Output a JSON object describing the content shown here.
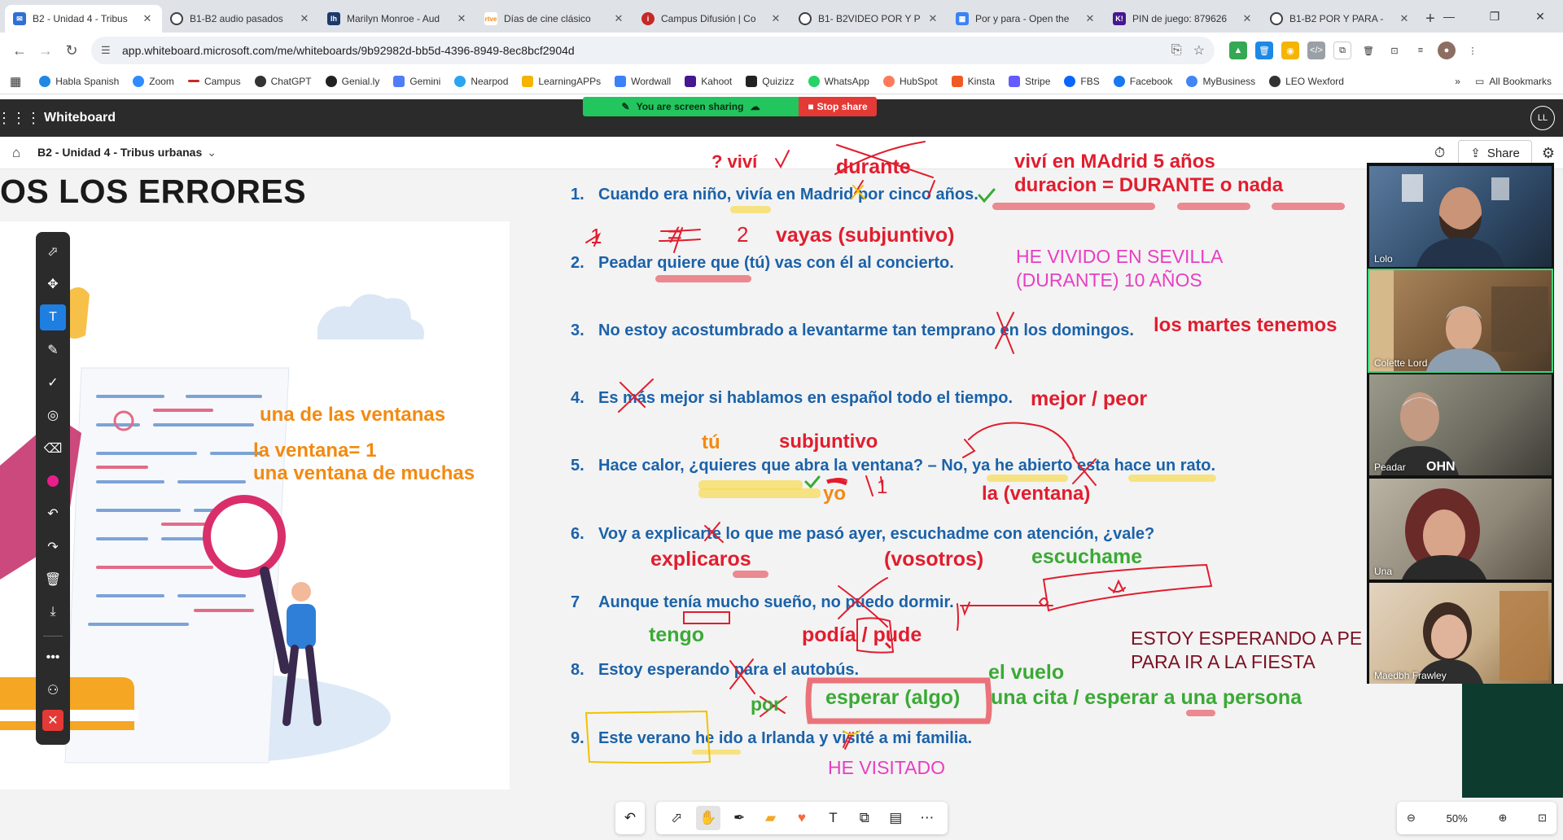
{
  "browser": {
    "tabs": [
      {
        "label": "B2 - Unidad 4 - Tribus",
        "icon": "outlook-icon",
        "color": "#2f6fd6",
        "active": true
      },
      {
        "label": "B1-B2 audio pasados",
        "icon": "web-icon",
        "color": "#3c4043",
        "active": false
      },
      {
        "label": "Marilyn Monroe - Aud",
        "icon": "lh-icon",
        "color": "#1d3a6b",
        "active": false
      },
      {
        "label": "Días de cine clásico",
        "icon": "rtve-icon",
        "color": "#f28a12",
        "active": false
      },
      {
        "label": "Campus Difusión | Co",
        "icon": "difusion-icon",
        "color": "#c62828",
        "active": false
      },
      {
        "label": "B1- B2VIDEO POR Y P",
        "icon": "web-icon",
        "color": "#3c4043",
        "active": false
      },
      {
        "label": "Por y para - Open the",
        "icon": "wordwall-icon",
        "color": "#3b82f6",
        "active": false
      },
      {
        "label": "PIN de juego: 879626",
        "icon": "kahoot-icon",
        "color": "#46178f",
        "active": false
      },
      {
        "label": "B1-B2 POR Y PARA -",
        "icon": "web-icon",
        "color": "#3c4043",
        "active": false
      }
    ],
    "url": "app.whiteboard.microsoft.com/me/whiteboards/9b92982d-bb5d-4396-8949-8ec8bcf2904d",
    "bookmarks": [
      {
        "label": "Habla Spanish",
        "color": "#1e88e5"
      },
      {
        "label": "Zoom",
        "color": "#2d8cff"
      },
      {
        "label": "Campus",
        "color": "#c62828"
      },
      {
        "label": "ChatGPT",
        "color": "#333333"
      },
      {
        "label": "Genial.ly",
        "color": "#222222"
      },
      {
        "label": "Gemini",
        "color": "#4f7cf7"
      },
      {
        "label": "Nearpod",
        "color": "#2ba4f2"
      },
      {
        "label": "LearningAPPs",
        "color": "#f5b400"
      },
      {
        "label": "Wordwall",
        "color": "#3b82f6"
      },
      {
        "label": "Kahoot",
        "color": "#46178f"
      },
      {
        "label": "Quizizz",
        "color": "#222222"
      },
      {
        "label": "WhatsApp",
        "color": "#25d366"
      },
      {
        "label": "HubSpot",
        "color": "#ff7a59"
      },
      {
        "label": "Kinsta",
        "color": "#f05a22"
      },
      {
        "label": "Stripe",
        "color": "#635bff"
      },
      {
        "label": "FBS",
        "color": "#0866ff"
      },
      {
        "label": "Facebook",
        "color": "#1877f2"
      },
      {
        "label": "MyBusiness",
        "color": "#4285f4"
      },
      {
        "label": "LEO Wexford",
        "color": "#333333"
      }
    ],
    "all_bookmarks": "All Bookmarks"
  },
  "whiteboard": {
    "app_name": "Whiteboard",
    "board_name": "B2 - Unidad 4 - Tribus urbanas",
    "screen_sharing": "You are screen sharing",
    "stop_share": "Stop share",
    "share": "Share",
    "user_initials": "LL",
    "zoom": "50%"
  },
  "slide": {
    "title": "OS LOS ERRORES",
    "sentences": [
      {
        "num": "1.",
        "text": "Cuando era niño, vivía en Madrid por cinco años."
      },
      {
        "num": "2.",
        "text": "Peadar quiere que (tú) vas con él al concierto."
      },
      {
        "num": "3.",
        "text": "No estoy acostumbrado a levantarme tan temprano en los domingos."
      },
      {
        "num": "4.",
        "text": "Es más mejor si hablamos en español todo el tiempo."
      },
      {
        "num": "5.",
        "text": "Hace calor, ¿quieres que abra la ventana? – No, ya he abierto esta hace un rato."
      },
      {
        "num": "6.",
        "text": "Voy a explicarte lo que me pasó ayer, escuchadme con atención, ¿vale?"
      },
      {
        "num": "7",
        "text": "Aunque tenía mucho sueño, no puedo dormir."
      },
      {
        "num": "8.",
        "text": "Estoy esperando para el autobús."
      },
      {
        "num": "9.",
        "text": "Este verano he ido a Irlanda y visité a mi familia."
      }
    ]
  },
  "annotations": {
    "a_vivi": "? viví",
    "a_durante": "durante",
    "a_vivi_madrid": "viví en MAdrid 5 años",
    "a_duracion": "duracion = DURANTE o nada",
    "a_one": "1",
    "a_neq": "≠",
    "a_two": "2",
    "a_vayas": "vayas (subjuntivo)",
    "a_he_vivido": "HE VIVIDO EN SEVILLA",
    "a_durante_10": "(DURANTE) 10 AÑOS",
    "a_martes": "los martes tenemos",
    "a_mejor_peor": "mejor / peor",
    "a_una_de": "una de las ventanas",
    "a_la_ventana1": "la ventana= 1",
    "a_una_ventana": "una ventana de muchas",
    "a_tu": "tú",
    "a_subjuntivo": "subjuntivo",
    "a_yo": "yo",
    "a_one_b": "1",
    "a_la_ventana": "la (ventana)",
    "a_explicaros": "explicaros",
    "a_vosotros": "(vosotros)",
    "a_escuchame": "escuchame",
    "a_tengo": "tengo",
    "a_podia": "podía / pude",
    "a_estoy_esperando": "ESTOY ESPERANDO A PE",
    "a_para_ir": "PARA IR A LA FIESTA",
    "a_el_vuelo": "el vuelo",
    "a_esperar_algo": "esperar (algo)",
    "a_una_cita": "una cita / esperar a una persona",
    "a_por": "por",
    "a_he_visitado": "HE VISITADO"
  },
  "participants": [
    {
      "name": "Lolo",
      "speaking": false
    },
    {
      "name": "Colette Lord",
      "speaking": true
    },
    {
      "name": "Peadar",
      "speaking": false
    },
    {
      "name": "Una",
      "speaking": false
    },
    {
      "name": "Maedbh Frawley",
      "speaking": false
    }
  ]
}
